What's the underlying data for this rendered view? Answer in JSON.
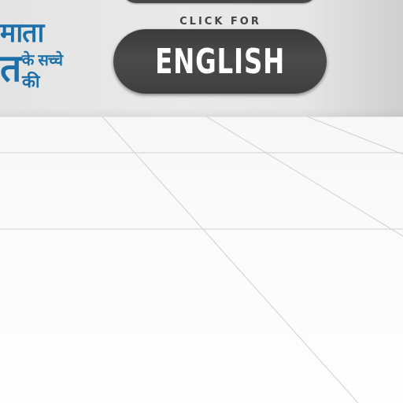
{
  "header": {
    "click_for_label": "CLICK FOR",
    "language_button_label": "ENGLISH"
  },
  "logo": {
    "line1": "माता",
    "line2_large": "त",
    "line2_small": "के सच्चे",
    "line3": "की"
  },
  "colors": {
    "logo_blue": "#1c6fa8",
    "button_dark": "#444444",
    "button_text": "#ffffff",
    "wall": "#e6e6e6",
    "floor": "#fafafa"
  }
}
